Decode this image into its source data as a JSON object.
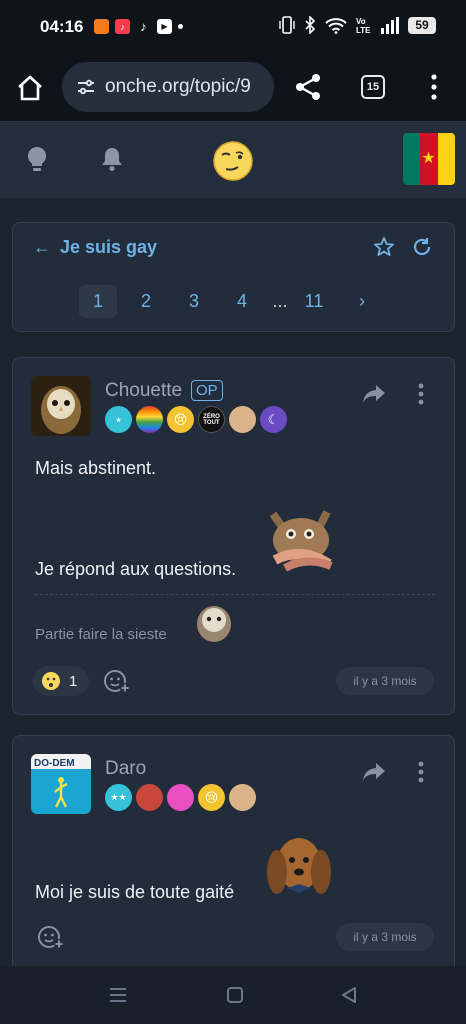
{
  "status_bar": {
    "time": "04:16",
    "battery": "59"
  },
  "browser": {
    "url": "onche.org/topic/9",
    "tab_count": "15"
  },
  "site": {
    "flag_colors": [
      "#007a5e",
      "#ce1126",
      "#fcd116"
    ]
  },
  "topic": {
    "title": "Je suis gay",
    "pages": [
      "1",
      "2",
      "3",
      "4",
      "...",
      "11"
    ],
    "current_page": "1",
    "next_label": "›"
  },
  "posts": [
    {
      "author": "Chouette",
      "op_label": "OP",
      "lines": [
        "Mais abstinent.",
        "Je répond aux questions."
      ],
      "signature": "Partie faire la sieste",
      "reaction_count": "1",
      "time": "il y a 3 mois",
      "badges": [
        "star-badge",
        "rainbow-badge",
        "crying-badge",
        "zero-tout-badge",
        "cat-badge",
        "moon-badge"
      ],
      "badge_text_zero": "ZÉRO TOUT"
    },
    {
      "author": "Daro",
      "avatar_text": "DO-DEM",
      "lines": [
        "Moi je suis de toute gaité"
      ],
      "time": "il y a 3 mois",
      "badges": [
        "double-star-badge",
        "apple-badge",
        "baby-badge",
        "crying-badge",
        "cat-badge"
      ]
    }
  ]
}
